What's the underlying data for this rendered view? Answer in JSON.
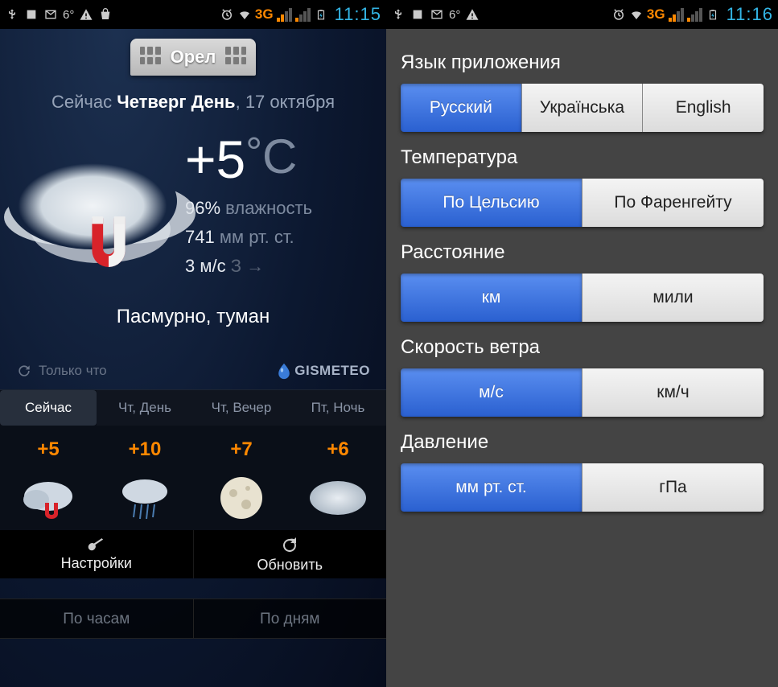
{
  "status_left": {
    "temp": "6°",
    "clock": "11:15",
    "net": "3G"
  },
  "status_right": {
    "temp": "6°",
    "clock": "11:16",
    "net": "3G"
  },
  "weather": {
    "city": "Орел",
    "now_label": "Сейчас",
    "day_label": "Четверг День",
    "date_label": ", 17 октября",
    "temp_value": "+5",
    "temp_unit_deg": "°",
    "temp_unit_c": "C",
    "humidity_val": "96%",
    "humidity_label": "влажность",
    "pressure_val": "741",
    "pressure_label": "мм рт. ст.",
    "wind_val": "3 м/с",
    "wind_dir": "З →",
    "condition": "Пасмурно, туман",
    "updated": "Только что",
    "brand": "GISMETEO"
  },
  "forecast": {
    "tabs": [
      "Сейчас",
      "Чт, День",
      "Чт, Вечер",
      "Пт, Ночь"
    ],
    "temps": [
      "+5",
      "+10",
      "+7",
      "+6"
    ]
  },
  "overlay": {
    "hourly": "По часам",
    "daily": "По дням"
  },
  "bottom": {
    "settings": "Настройки",
    "refresh": "Обновить"
  },
  "settings": {
    "lang": {
      "title": "Язык приложения",
      "opts": [
        "Русский",
        "Українська",
        "English"
      ],
      "selected": 0
    },
    "temp": {
      "title": "Температура",
      "opts": [
        "По Цельсию",
        "По Фаренгейту"
      ],
      "selected": 0
    },
    "dist": {
      "title": "Расстояние",
      "opts": [
        "км",
        "мили"
      ],
      "selected": 0
    },
    "wind": {
      "title": "Скорость ветра",
      "opts": [
        "м/с",
        "км/ч"
      ],
      "selected": 0
    },
    "pressure": {
      "title": "Давление",
      "opts": [
        "мм рт. ст.",
        "гПа"
      ],
      "selected": 0
    }
  }
}
